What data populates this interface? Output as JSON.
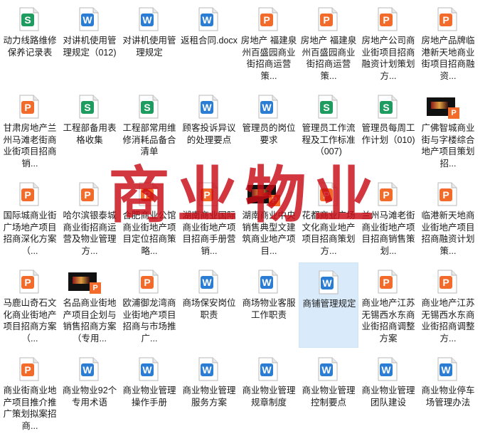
{
  "colors": {
    "word": "#2b7cd3",
    "excel": "#1e9b5f",
    "pdf": "#f26b2b",
    "selected_bg": "#d9ebfb",
    "watermark": "#c80a14"
  },
  "watermark_text": "商业物业",
  "files": [
    {
      "label": "动力线路维修保养记录表",
      "icon": "excel-sheet-icon"
    },
    {
      "label": "对讲机使用管理规定（012)",
      "icon": "word-doc-icon"
    },
    {
      "label": "对讲机使用管理规定",
      "icon": "word-doc-icon"
    },
    {
      "label": "返租合同.docx",
      "icon": "word-doc-icon"
    },
    {
      "label": "房地产 福建泉州百盛园商业街招商运营策...",
      "icon": "pdf-doc-icon"
    },
    {
      "label": "房地产 福建泉州百盛园商业街招商运营策...",
      "icon": "pdf-doc-icon"
    },
    {
      "label": "房地产公司商业街项目招商融资计划策划方...",
      "icon": "pdf-doc-icon"
    },
    {
      "label": "房地产品牌临港新天地商业街项目招商融资...",
      "icon": "pdf-doc-icon"
    },
    {
      "label": "甘肃房地产兰州马滩老街商业街项目招商销...",
      "icon": "pdf-doc-icon"
    },
    {
      "label": "工程部备用表格收集",
      "icon": "excel-sheet-icon"
    },
    {
      "label": "工程部常用维修消耗品备合清单",
      "icon": "excel-sheet-icon"
    },
    {
      "label": "顾客投诉异议的处理要点",
      "icon": "word-doc-icon"
    },
    {
      "label": "管理员的岗位要求",
      "icon": "word-doc-icon"
    },
    {
      "label": "管理员工作流程及工作标准（007)",
      "icon": "excel-sheet-icon"
    },
    {
      "label": "管理员每周工作计划（010)",
      "icon": "excel-sheet-icon"
    },
    {
      "label": "广佛智城商业街与字楼综合地产项目策划招...",
      "icon": "pdf-thumbnail-icon"
    },
    {
      "label": "国际城商业街广场地产项目招商深化方案（...",
      "icon": "pdf-doc-icon"
    },
    {
      "label": "哈尔滨银泰城商业街招商运营及物业管理方...",
      "icon": "pdf-doc-icon"
    },
    {
      "label": "合肥商业公馆商业街地产项目定位招商策略...",
      "icon": "pdf-doc-icon"
    },
    {
      "label": "湖南商业国际商业街地产项目招商手册营销...",
      "icon": "pdf-doc-icon"
    },
    {
      "label": "湖南商业中央销售典型文建筑商业地产项目...",
      "icon": "pdf-thumbnail-icon"
    },
    {
      "label": "花都商业广场文化商业地产项目招商策划方...",
      "icon": "pdf-doc-icon"
    },
    {
      "label": "兰州马滩老街商业街地产项目招商销售策划...",
      "icon": "pdf-doc-icon"
    },
    {
      "label": "临港新天地商业街地产项目招商融资计划策...",
      "icon": "pdf-doc-icon"
    },
    {
      "label": "马鹿山奇石文化商业街地产项目招商方案（...",
      "icon": "pdf-doc-icon"
    },
    {
      "label": "名品商业街地产项目企划与销售招商方案（专用...",
      "icon": "pdf-thumbnail-icon"
    },
    {
      "label": "欧浦御龙湾商业街地产项目招商与市场推广...",
      "icon": "pdf-doc-icon"
    },
    {
      "label": "商场保安岗位职责",
      "icon": "word-doc-icon"
    },
    {
      "label": "商场物业客服工作职责",
      "icon": "word-doc-icon"
    },
    {
      "label": "商铺管理规定",
      "icon": "word-doc-icon",
      "selected": true
    },
    {
      "label": "商业地产江苏无锡西水东商业街招商调整方案",
      "icon": "pdf-doc-icon"
    },
    {
      "label": "商业地产江苏无锡西水东商业街招商调整方...",
      "icon": "pdf-doc-icon"
    },
    {
      "label": "商业街商业地产项目推介推广策划拟案招商...",
      "icon": "pdf-doc-icon"
    },
    {
      "label": "商业物业92个专用术语",
      "icon": "word-doc-icon"
    },
    {
      "label": "商业物业管理操作手册",
      "icon": "word-doc-icon"
    },
    {
      "label": "商业物业管理服务方案",
      "icon": "word-doc-icon"
    },
    {
      "label": "商业物业管理规章制度",
      "icon": "word-doc-icon"
    },
    {
      "label": "商业物业管理控制要点",
      "icon": "word-doc-icon"
    },
    {
      "label": "商业物业管理团队建设",
      "icon": "word-doc-icon"
    },
    {
      "label": "商业物业停车场管理办法",
      "icon": "word-doc-icon"
    }
  ]
}
